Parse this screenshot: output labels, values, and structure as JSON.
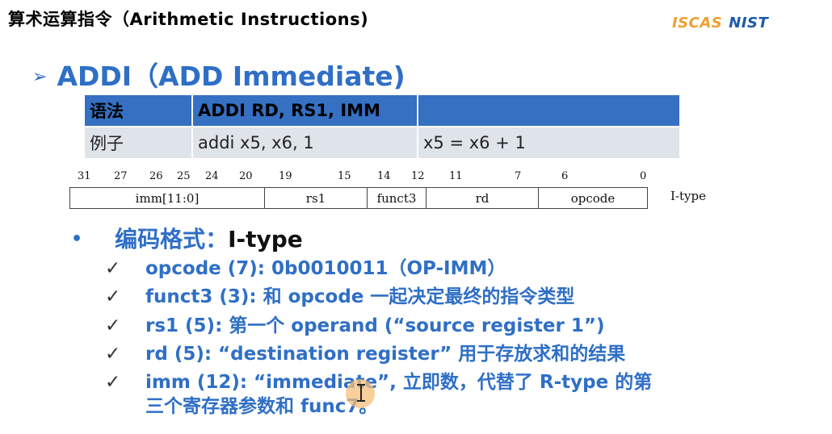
{
  "header": {
    "title": "算术运算指令（Arithmetic Instructions)"
  },
  "logo": {
    "left": "ISCAS",
    "right": "NIST"
  },
  "slide": {
    "arrow": "➢",
    "heading": "ADDI（ADD Immediate)"
  },
  "syntax_table": {
    "header": [
      "语法",
      "ADDI RD, RS1, IMM",
      ""
    ],
    "example": [
      "例子",
      "addi x5, x6, 1",
      "x5 = x6 + 1"
    ]
  },
  "encoding": {
    "bit_numbers": [
      "31",
      "27",
      "26",
      "25",
      "24",
      "20",
      "19",
      "15",
      "14",
      "12",
      "11",
      "7",
      "6",
      "0"
    ],
    "fields": [
      "imm[11:0]",
      "rs1",
      "funct3",
      "rd",
      "opcode"
    ],
    "type_label": "I-type"
  },
  "bullets": {
    "main_dot": "•",
    "main_cn": "编码格式：",
    "main_en": "I-type",
    "check": "✓",
    "items": [
      "opcode (7):  0b0010011（OP-IMM）",
      "funct3 (3): 和 opcode 一起决定最终的指令类型",
      "rs1 (5): 第一个 operand (“source register 1”)",
      "rd (5): “destination register” 用于存放求和的结果",
      "imm (12): “immediate”, 立即数，代替了 R-type 的第"
    ],
    "continuation": "三个寄存器参数和 func7。"
  }
}
